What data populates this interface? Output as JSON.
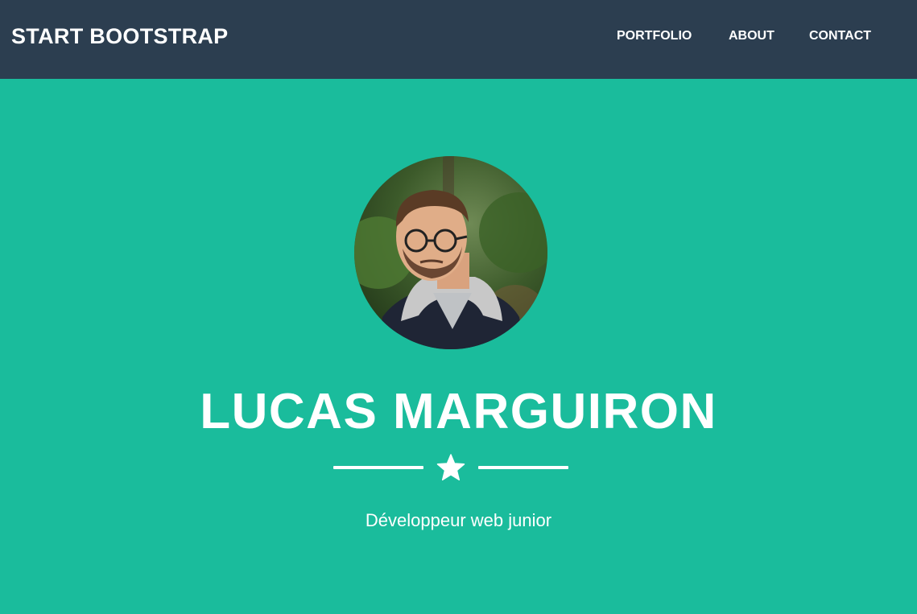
{
  "navbar": {
    "brand": "START BOOTSTRAP",
    "links": [
      {
        "label": "PORTFOLIO"
      },
      {
        "label": "ABOUT"
      },
      {
        "label": "CONTACT"
      }
    ]
  },
  "masthead": {
    "avatar_icon": "profile-photo",
    "name": "LUCAS MARGUIRON",
    "divider_icon": "star-icon",
    "subtitle": "Développeur web junior"
  },
  "colors": {
    "navbar_bg": "#2c3e50",
    "primary": "#1abc9c",
    "text": "#ffffff"
  }
}
